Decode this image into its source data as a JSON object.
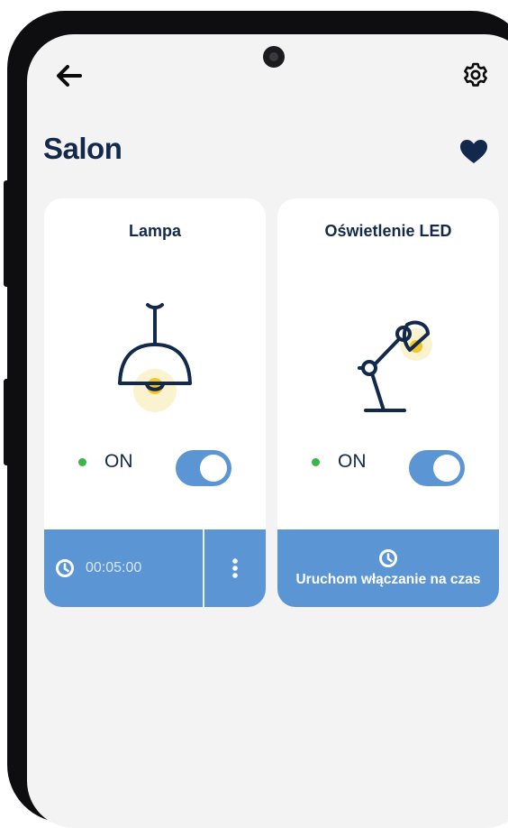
{
  "header": {
    "title": "Salon",
    "back_icon": "arrow-left-icon",
    "settings_icon": "gear-icon",
    "favorite_icon": "heart-icon"
  },
  "devices": [
    {
      "name": "Lampa",
      "icon": "pendant-lamp-icon",
      "status_label": "ON",
      "toggle_on": true,
      "timer": "00:05:00",
      "timer_icon": "clock-icon",
      "more_icon": "more-vertical-icon"
    },
    {
      "name": "Oświetlenie LED",
      "icon": "desk-lamp-icon",
      "status_label": "ON",
      "toggle_on": true,
      "schedule_label": "Uruchom włączanie na czas",
      "schedule_icon": "clock-icon"
    }
  ],
  "colors": {
    "primary": "#13294b",
    "accent": "#5b95d4",
    "status_on": "#3bb54a",
    "bulb": "#f3c623",
    "background": "#f3f3f4",
    "card": "#ffffff"
  }
}
